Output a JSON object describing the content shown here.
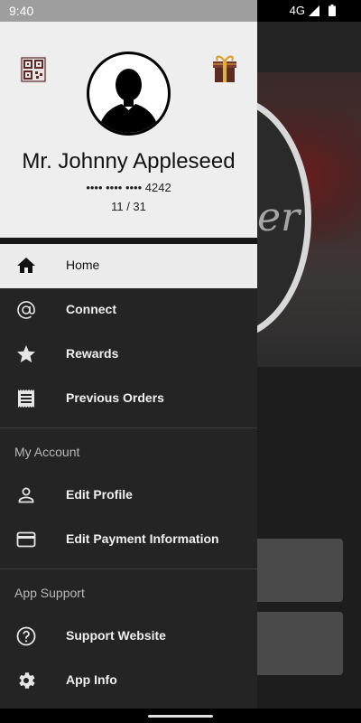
{
  "status_bar": {
    "time": "9:40",
    "network": "4G"
  },
  "drawer": {
    "user": {
      "name": "Mr. Johnny Appleseed",
      "card_number": "•••• •••• •••• 4242",
      "punch_count": "11 / 31"
    },
    "icons": {
      "left": "qr-code-icon",
      "right": "gift-icon"
    },
    "nav_items": [
      {
        "label": "Home",
        "icon": "home-icon",
        "active": true
      },
      {
        "label": "Connect",
        "icon": "at-sign-icon"
      },
      {
        "label": "Rewards",
        "icon": "star-icon"
      },
      {
        "label": "Previous Orders",
        "icon": "receipt-icon"
      }
    ],
    "sections": [
      {
        "title": "My Account",
        "items": [
          {
            "label": "Edit Profile",
            "icon": "person-icon"
          },
          {
            "label": "Edit Payment Information",
            "icon": "credit-card-icon"
          }
        ]
      },
      {
        "title": "App Support",
        "items": [
          {
            "label": "Support Website",
            "icon": "help-circle-icon"
          },
          {
            "label": "App Info",
            "icon": "gear-icon"
          }
        ]
      }
    ]
  },
  "background": {
    "hero_script_text": "er"
  },
  "colors": {
    "drawer_bg": "#242424",
    "header_bg": "#eeeeee",
    "active_bg": "#ececec",
    "text_light": "#f0f0f0"
  }
}
